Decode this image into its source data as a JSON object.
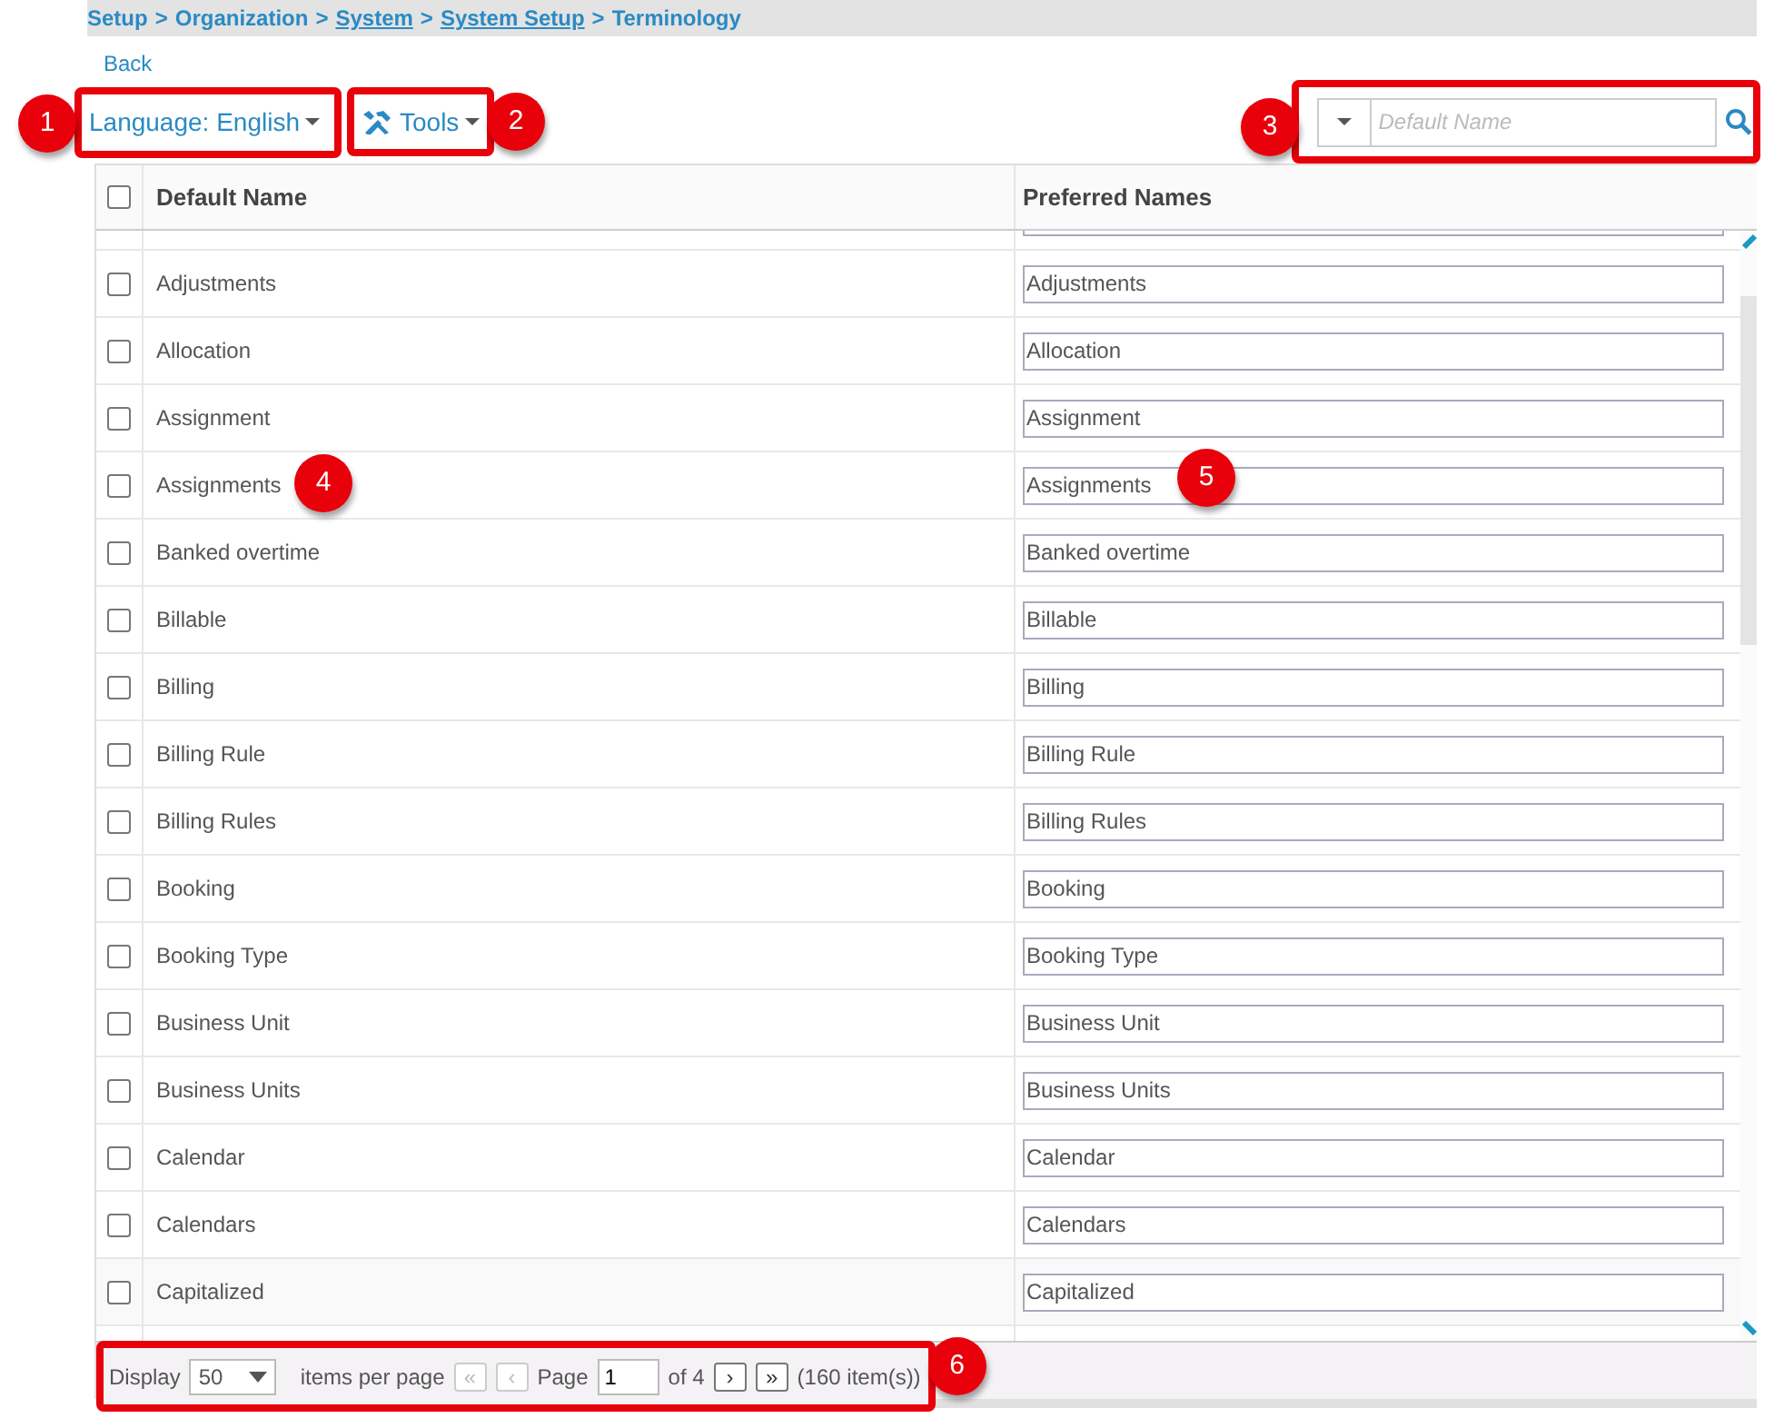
{
  "breadcrumb": [
    {
      "label": "Setup",
      "link": false
    },
    {
      "label": "Organization",
      "link": false
    },
    {
      "label": "System",
      "link": true
    },
    {
      "label": "System Setup",
      "link": true
    },
    {
      "label": "Terminology",
      "link": false
    }
  ],
  "separator": ">",
  "back_link": "Back",
  "language_menu": {
    "label": "Language: English"
  },
  "tools_menu": {
    "label": "Tools"
  },
  "search": {
    "placeholder": "Default Name"
  },
  "table": {
    "columns": [
      "Default Name",
      "Preferred Names"
    ],
    "header_checked": false,
    "rows": [
      {
        "default_name": "Adjustments",
        "preferred_name": "Adjustments",
        "checked": false
      },
      {
        "default_name": "Allocation",
        "preferred_name": "Allocation",
        "checked": false
      },
      {
        "default_name": "Assignment",
        "preferred_name": "Assignment",
        "checked": false
      },
      {
        "default_name": "Assignments",
        "preferred_name": "Assignments",
        "checked": false
      },
      {
        "default_name": "Banked overtime",
        "preferred_name": "Banked overtime",
        "checked": false
      },
      {
        "default_name": "Billable",
        "preferred_name": "Billable",
        "checked": false
      },
      {
        "default_name": "Billing",
        "preferred_name": "Billing",
        "checked": false
      },
      {
        "default_name": "Billing Rule",
        "preferred_name": "Billing Rule",
        "checked": false
      },
      {
        "default_name": "Billing Rules",
        "preferred_name": "Billing Rules",
        "checked": false
      },
      {
        "default_name": "Booking",
        "preferred_name": "Booking",
        "checked": false
      },
      {
        "default_name": "Booking Type",
        "preferred_name": "Booking Type",
        "checked": false
      },
      {
        "default_name": "Business Unit",
        "preferred_name": "Business Unit",
        "checked": false
      },
      {
        "default_name": "Business Units",
        "preferred_name": "Business Units",
        "checked": false
      },
      {
        "default_name": "Calendar",
        "preferred_name": "Calendar",
        "checked": false
      },
      {
        "default_name": "Calendars",
        "preferred_name": "Calendars",
        "checked": false
      },
      {
        "default_name": "Capitalized",
        "preferred_name": "Capitalized",
        "checked": false
      }
    ]
  },
  "pager": {
    "display_label": "Display",
    "page_size": "50",
    "per_page_label": "items per page",
    "page_label": "Page",
    "page": "1",
    "of_label": "of 4",
    "total": "(160 item(s))",
    "first_symbol": "«",
    "prev_symbol": "‹",
    "next_symbol": "›",
    "last_symbol": "»",
    "first_disabled": true,
    "prev_disabled": true
  },
  "callouts": [
    {
      "number": "1"
    },
    {
      "number": "2"
    },
    {
      "number": "3"
    },
    {
      "number": "4"
    },
    {
      "number": "5"
    },
    {
      "number": "6"
    }
  ]
}
